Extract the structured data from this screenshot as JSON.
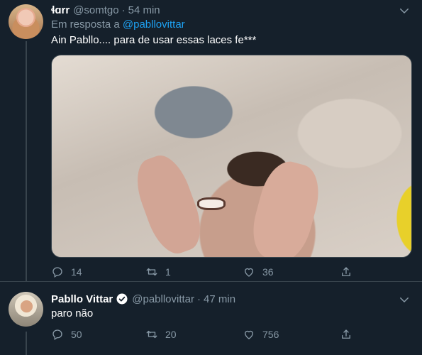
{
  "tweets": [
    {
      "name": "ɬɑrr",
      "handle": "@somtgo",
      "time": "54 min",
      "reply_prefix": "Em resposta a",
      "reply_mention": "@pabllovittar",
      "text": "Ain Pabllo.... para de usar essas laces fe***",
      "replies": "14",
      "retweets": "1",
      "likes": "36",
      "has_media": true
    },
    {
      "name": "Pabllo Vittar",
      "handle": "@pabllovittar",
      "time": "47 min",
      "verified": true,
      "text": "paro não",
      "replies": "50",
      "retweets": "20",
      "likes": "756"
    }
  ],
  "separator": "·",
  "colors": {
    "background": "#15202b",
    "secondary_text": "#8899a6",
    "link": "#1da1f2",
    "border": "#38444d"
  }
}
